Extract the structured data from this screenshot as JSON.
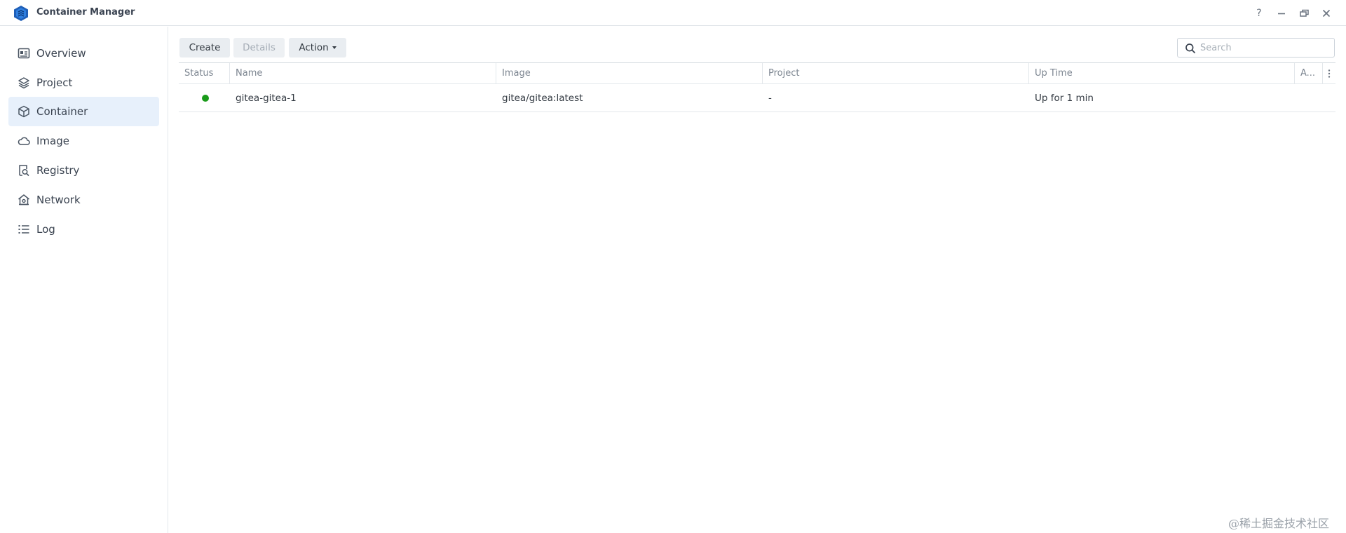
{
  "app": {
    "title": "Container Manager",
    "accent_color": "#2a6fc9",
    "logo_icon": "container-manager-hexagon-icon"
  },
  "window_controls": {
    "help": "?",
    "icons": [
      "help-icon",
      "minimize-icon",
      "restore-icon",
      "close-icon"
    ]
  },
  "sidebar": {
    "active": "Container",
    "items": [
      {
        "label": "Overview",
        "icon": "overview-icon"
      },
      {
        "label": "Project",
        "icon": "layers-icon"
      },
      {
        "label": "Container",
        "icon": "cube-icon"
      },
      {
        "label": "Image",
        "icon": "cloud-icon"
      },
      {
        "label": "Registry",
        "icon": "registry-search-icon"
      },
      {
        "label": "Network",
        "icon": "network-house-icon"
      },
      {
        "label": "Log",
        "icon": "list-icon"
      }
    ]
  },
  "toolbar": {
    "create_label": "Create",
    "details_label": "Details",
    "action_label": "Action"
  },
  "search": {
    "placeholder": "Search",
    "value": ""
  },
  "table": {
    "columns": [
      "Status",
      "Name",
      "Image",
      "Project",
      "Up Time",
      "A..."
    ],
    "rows": [
      {
        "status": "running",
        "status_color": "#1a9b1a",
        "name": "gitea-gitea-1",
        "image": "gitea/gitea:latest",
        "project": "-",
        "up_time": "Up for 1 min"
      }
    ]
  },
  "watermark": "@稀土掘金技术社区"
}
